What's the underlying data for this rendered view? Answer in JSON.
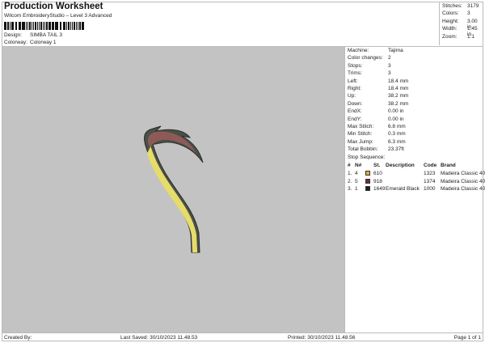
{
  "header": {
    "title": "Production Worksheet",
    "subtitle": "Wilcom EmbroideryStudio – Level 3 Advanced",
    "design_label": "Design:",
    "design_value": "SIMBA TAIL 3",
    "colorway_label": "Colorway:",
    "colorway_value": "Colorway 1"
  },
  "stats": [
    {
      "label": "Stitches:",
      "value": "3179"
    },
    {
      "label": "Colors:",
      "value": "3"
    },
    {
      "label": "Height:",
      "value": "3.00 in"
    },
    {
      "label": "Width:",
      "value": "1.45 in"
    },
    {
      "label": "Zoom:",
      "value": "1:1"
    }
  ],
  "info": [
    {
      "label": "Machine:",
      "value": "Tajima"
    },
    {
      "label": "Color changes:",
      "value": "2"
    },
    {
      "label": "Stops:",
      "value": "3"
    },
    {
      "label": "Trims:",
      "value": "3"
    },
    {
      "label": "Left:",
      "value": "18.4 mm"
    },
    {
      "label": "Right:",
      "value": "18.4 mm"
    },
    {
      "label": "Up:",
      "value": "38.2 mm"
    },
    {
      "label": "Down:",
      "value": "38.2 mm"
    },
    {
      "label": "EndX:",
      "value": "0.00 in"
    },
    {
      "label": "EndY:",
      "value": "0.00 in"
    },
    {
      "label": "Max Stitch:",
      "value": "6.8 mm"
    },
    {
      "label": "Min Stitch:",
      "value": "0.3 mm"
    },
    {
      "label": "Max Jump:",
      "value": "6.3 mm"
    },
    {
      "label": "Total Bobbin:",
      "value": "23.37ft"
    }
  ],
  "stop_sequence": {
    "title": "Stop Sequence:",
    "headers": {
      "num": "#",
      "n": "N#",
      "st": "St.",
      "desc": "Description",
      "code": "Code",
      "brand": "Brand"
    },
    "rows": [
      {
        "num": "1.",
        "n": "4",
        "color": "#d4b040",
        "st": "610",
        "desc": "",
        "code": "1323",
        "brand": "Madeira Classic 40"
      },
      {
        "num": "2.",
        "n": "5",
        "color": "#7a2a35",
        "st": "918",
        "desc": "",
        "code": "1374",
        "brand": "Madeira Classic 40"
      },
      {
        "num": "3.",
        "n": "1",
        "color": "#1e1e1e",
        "st": "1649",
        "desc": "Emerald Black",
        "code": "1000",
        "brand": "Madeira Classic 40"
      }
    ]
  },
  "footer": {
    "created": "Created By:",
    "saved": "Last Saved: 30/10/2023 11.48.53",
    "printed": "Printed: 30/10/2023 11.48.56",
    "page": "Page 1 of 1"
  }
}
